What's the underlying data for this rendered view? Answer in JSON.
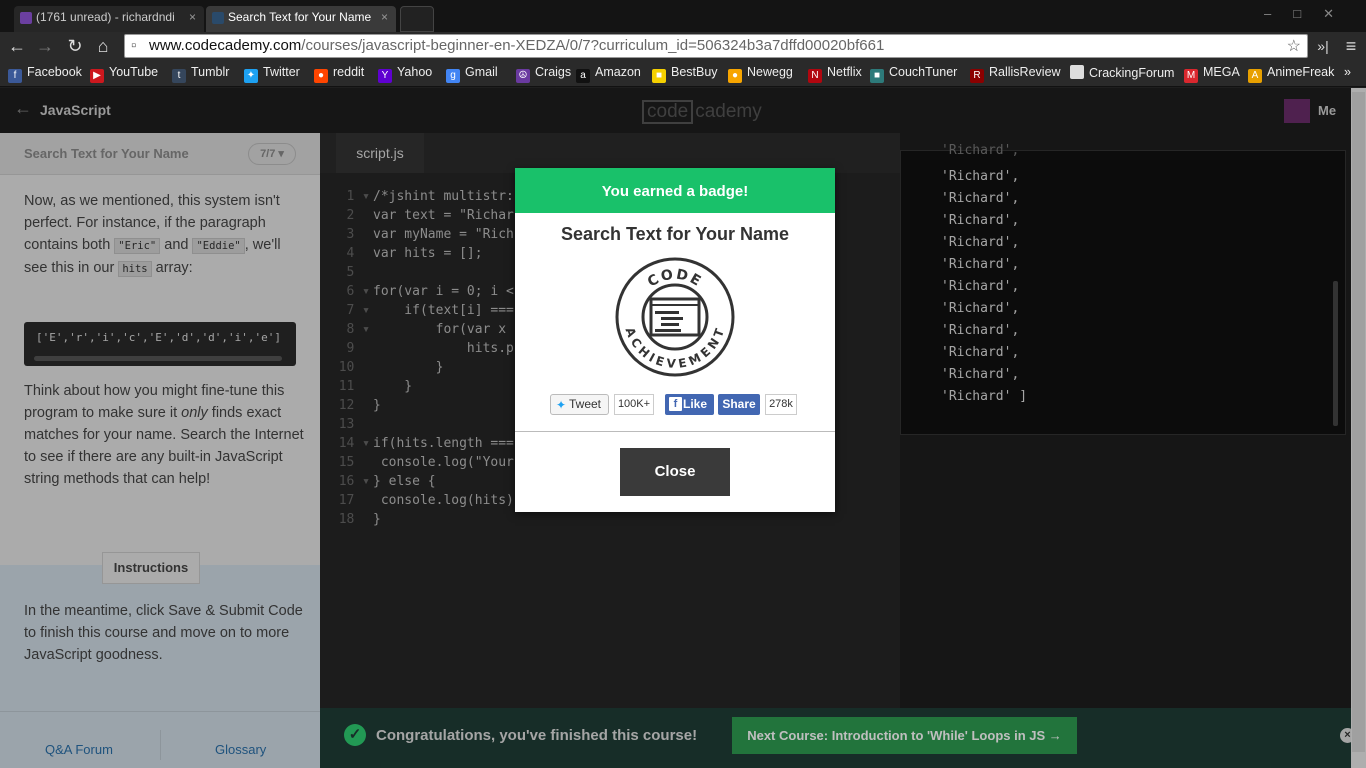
{
  "browser": {
    "tabs": [
      {
        "label": "(1761 unread) - richardndi",
        "icon_color": "#6b3fa0"
      },
      {
        "label": "Search Text for Your Name",
        "icon_color": "#2a4a6a"
      }
    ],
    "tab_close": "×",
    "url_host": "www.codecademy.com",
    "url_path": "/courses/javascript-beginner-en-XEDZA/0/7?curriculum_id=506324b3a7dffd00020bf661",
    "bookmarks": [
      {
        "label": "Facebook",
        "icon": "facebook-icon",
        "color": "#3b5998",
        "glyph": "f"
      },
      {
        "label": "YouTube",
        "icon": "youtube-icon",
        "color": "#cc181e",
        "glyph": "▶"
      },
      {
        "label": "Tumblr",
        "icon": "tumblr-icon",
        "color": "#35465c",
        "glyph": "t"
      },
      {
        "label": "Twitter",
        "icon": "twitter-icon",
        "color": "#1da1f2",
        "glyph": "✦"
      },
      {
        "label": "reddit",
        "icon": "reddit-icon",
        "color": "#ff4500",
        "glyph": "●"
      },
      {
        "label": "Yahoo",
        "icon": "yahoo-icon",
        "color": "#5f01d1",
        "glyph": "Y"
      },
      {
        "label": "Gmail",
        "icon": "gmail-icon",
        "color": "#4285f4",
        "glyph": "g"
      },
      {
        "label": "Craigs",
        "icon": "peace-icon",
        "color": "#6a3aa0",
        "glyph": "☮"
      },
      {
        "label": "Amazon",
        "icon": "amazon-icon",
        "color": "#111111",
        "glyph": "a"
      },
      {
        "label": "BestBuy",
        "icon": "bestbuy-icon",
        "color": "#f5d000",
        "glyph": "■"
      },
      {
        "label": "Newegg",
        "icon": "newegg-icon",
        "color": "#f7a500",
        "glyph": "●"
      },
      {
        "label": "Netflix",
        "icon": "netflix-icon",
        "color": "#b1060f",
        "glyph": "N"
      },
      {
        "label": "CouchTuner",
        "icon": "couchtuner-icon",
        "color": "#2d7a7a",
        "glyph": "■"
      },
      {
        "label": "RallisReview",
        "icon": "rallisreview-icon",
        "color": "#8b0000",
        "glyph": "R"
      },
      {
        "label": "CrackingForum",
        "icon": "page-icon",
        "color": "#dddddd",
        "glyph": ""
      },
      {
        "label": "MEGA",
        "icon": "mega-icon",
        "color": "#d9272e",
        "glyph": "M"
      },
      {
        "label": "AnimeFreak",
        "icon": "animefreak-icon",
        "color": "#e8a000",
        "glyph": "A"
      }
    ],
    "bookmarks_more": "»"
  },
  "header": {
    "back_label": "JavaScript",
    "logo_box": "code",
    "logo_rest": "cademy",
    "me_label": "Me"
  },
  "lesson": {
    "title": "Search Text for Your Name",
    "pager": "7/7 ▾",
    "p1_a": "Now, as we mentioned, this system isn't perfect. For instance, if the paragraph contains both ",
    "p1_code1": "\"Eric\"",
    "p1_b": " and ",
    "p1_code2": "\"Eddie\"",
    "p1_c": ", we'll see this in our ",
    "p1_code3": "hits",
    "p1_d": " array:",
    "array_text": "['E','r','i','c','E','d','d','i','e']",
    "p2_a": "Think about how you might fine-tune this program to make sure it ",
    "p2_em": "only",
    "p2_b": " finds exact matches for your name. Search the Internet to see if there are any built-in JavaScript string methods that can help!",
    "instructions_label": "Instructions",
    "instructions_text": "In the meantime, click Save & Submit Code to finish this course and move on to more JavaScript goodness.",
    "footer_links": [
      "Q&A Forum",
      "Glossary"
    ]
  },
  "editor": {
    "tab": "script.js",
    "lines": [
      {
        "n": "1",
        "fold": "▾",
        "code": "/*jshint multistr:"
      },
      {
        "n": "2",
        "fold": " ",
        "code": "var text = \"Richar"
      },
      {
        "n": "3",
        "fold": " ",
        "code": "var myName = \"Rich"
      },
      {
        "n": "4",
        "fold": " ",
        "code": "var hits = [];"
      },
      {
        "n": "5",
        "fold": " ",
        "code": ""
      },
      {
        "n": "6",
        "fold": "▾",
        "code": "for(var i = 0; i <"
      },
      {
        "n": "7",
        "fold": "▾",
        "code": "    if(text[i] ==="
      },
      {
        "n": "8",
        "fold": "▾",
        "code": "        for(var x"
      },
      {
        "n": "9",
        "fold": " ",
        "code": "            hits.p"
      },
      {
        "n": "10",
        "fold": " ",
        "code": "        }"
      },
      {
        "n": "11",
        "fold": " ",
        "code": "    }"
      },
      {
        "n": "12",
        "fold": " ",
        "code": "}"
      },
      {
        "n": "13",
        "fold": " ",
        "code": ""
      },
      {
        "n": "14",
        "fold": "▾",
        "code": "if(hits.length ==="
      },
      {
        "n": "15",
        "fold": " ",
        "code": " console.log(\"Your"
      },
      {
        "n": "16",
        "fold": "▾",
        "code": "} else {"
      },
      {
        "n": "17",
        "fold": " ",
        "code": " console.log(hits)"
      },
      {
        "n": "18",
        "fold": " ",
        "code": "}"
      }
    ]
  },
  "console": {
    "lines": [
      "'Richard',",
      "'Richard',",
      "'Richard',",
      "'Richard',",
      "'Richard',",
      "'Richard',",
      "'Richard',",
      "'Richard',",
      "'Richard',",
      "'Richard',",
      "'Richard' ]"
    ]
  },
  "congrats": {
    "text": "Congratulations, you've finished this course!",
    "next_label": "Next Course: Introduction to 'While' Loops in JS →",
    "check": "✓",
    "close": "×"
  },
  "modal": {
    "header": "You earned a badge!",
    "title": "Search Text for Your Name",
    "badge_top": "CODE",
    "badge_bottom": "ACHIEVEMENT",
    "tweet_label": "Tweet",
    "tweet_count": "100K+",
    "like_label": "Like",
    "share_label": "Share",
    "share_count": "278k",
    "close_label": "Close"
  },
  "colors": {
    "badge_green": "#19c16a",
    "next_button_green": "#2e9b50"
  }
}
